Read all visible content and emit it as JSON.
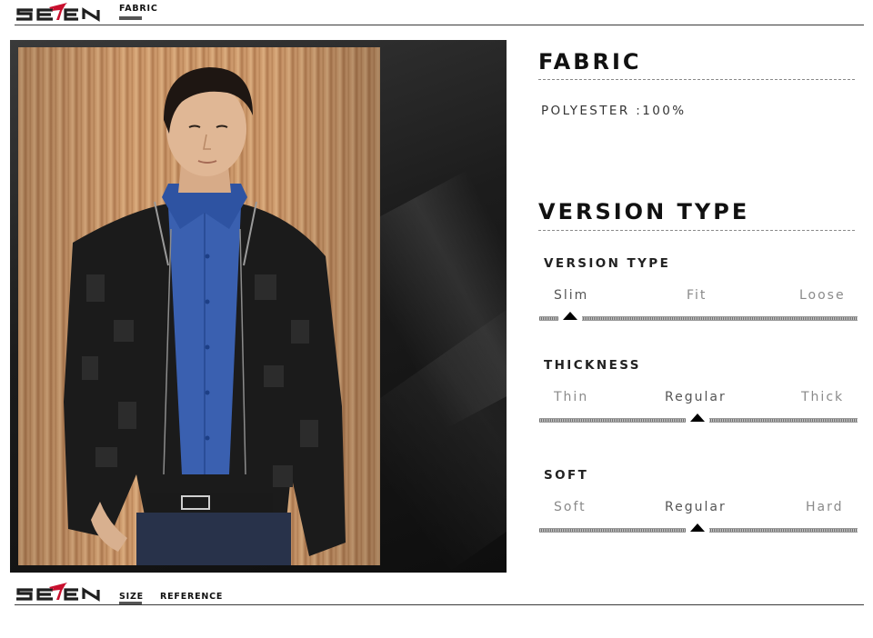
{
  "brand": {
    "name": "SEVEN",
    "accent_color": "#c8102e"
  },
  "top_bar": {
    "section_label": "FABRIC"
  },
  "bottom_bar": {
    "section_label_part1": "SIZE",
    "section_label_part2": "REFERENCE"
  },
  "fabric": {
    "heading": "FABRIC",
    "composition": "POLYESTER :100%"
  },
  "version": {
    "heading": "VERSION TYPE",
    "scales": [
      {
        "title": "VERSION TYPE",
        "options": [
          "Slim",
          "Fit",
          "Loose"
        ],
        "selected": "Slim",
        "selected_index": 0
      },
      {
        "title": "THICKNESS",
        "options": [
          "Thin",
          "Regular",
          "Thick"
        ],
        "selected": "Regular",
        "selected_index": 1
      },
      {
        "title": "SOFT",
        "options": [
          "Soft",
          "Regular",
          "Hard"
        ],
        "selected": "Regular",
        "selected_index": 1
      }
    ]
  },
  "icons": [
    "seven-logo-icon",
    "slider-pointer-icon"
  ]
}
